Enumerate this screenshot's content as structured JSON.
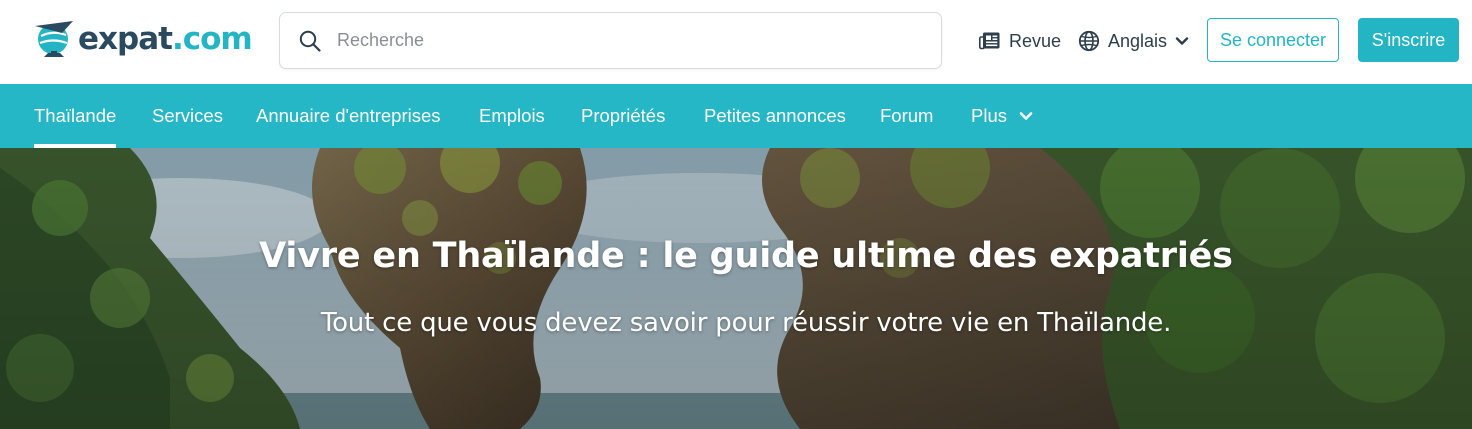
{
  "header": {
    "logo": {
      "name_main": "expat",
      "name_suffix": ".com"
    },
    "search": {
      "placeholder": "Recherche",
      "value": ""
    },
    "revue_label": "Revue",
    "language_label": "Anglais",
    "login_label": "Se connecter",
    "signup_label": "S'inscrire"
  },
  "nav": {
    "items": [
      {
        "label": "Thaïlande",
        "active": true
      },
      {
        "label": "Services"
      },
      {
        "label": "Annuaire d'entreprises"
      },
      {
        "label": "Emplois"
      },
      {
        "label": "Propriétés"
      },
      {
        "label": "Petites annonces"
      },
      {
        "label": "Forum"
      },
      {
        "label": "Plus"
      }
    ]
  },
  "hero": {
    "title": "Vivre en Thaïlande : le guide ultime des expatriés",
    "subtitle": "Tout ce que vous devez savoir pour réussir votre vie en Thaïlande."
  },
  "colors": {
    "brand_teal": "#26b7c6",
    "brand_navy": "#2a4a60",
    "text_dark": "#2d3e4d"
  },
  "icons": {
    "logo": "globe-plane-logo-icon",
    "search": "search-icon",
    "revue": "newspaper-icon",
    "language": "globe-icon",
    "dropdown": "chevron-down-icon"
  }
}
